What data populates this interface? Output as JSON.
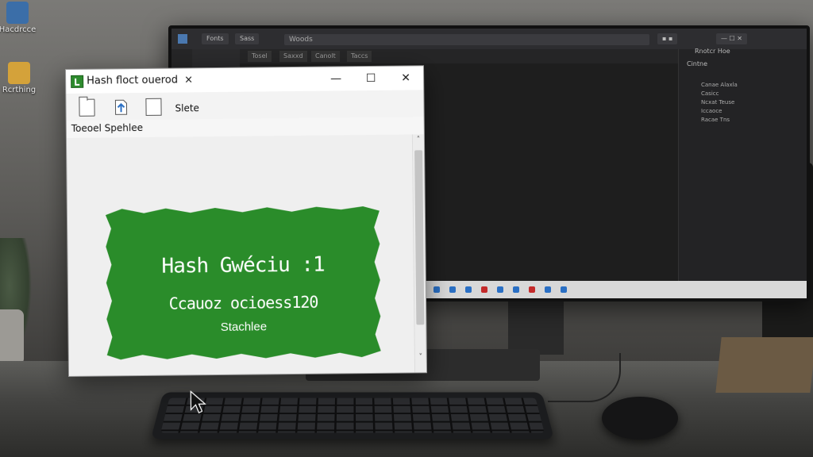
{
  "desktop": {
    "icons": [
      {
        "label": "Hacdrcce",
        "icon": "app-icon"
      },
      {
        "label": "Rcrthing",
        "icon": "folder-icon"
      }
    ]
  },
  "ide": {
    "title": "Woods",
    "tabs": [
      "Fonts",
      "Sass"
    ],
    "editor_tabs": [
      "Tosel",
      "Saxxd",
      "Canolt",
      "Taccs"
    ],
    "side_panel": {
      "header": "Rnotcr Hoe",
      "title": "Cintne",
      "items": [
        "Canae Alaxla",
        "Casicc",
        "Ncxat Teuse",
        "Iccaoce",
        "Racae Tns"
      ]
    }
  },
  "window": {
    "title": "Hash floct ouerod",
    "close_tab_glyph": "×",
    "controls": {
      "minimize": "—",
      "maximize": "☐",
      "close": "✕"
    },
    "toolbar": {
      "label": "Slete"
    },
    "location": "Toeoel Spehlee",
    "card": {
      "title": "Hash Gwéciu :1",
      "subtitle": "Ccauoz ocioess120",
      "small": "Stachlee",
      "color": "#2a8c2a"
    },
    "scroll": {
      "up": "˄",
      "down": "˅"
    }
  }
}
